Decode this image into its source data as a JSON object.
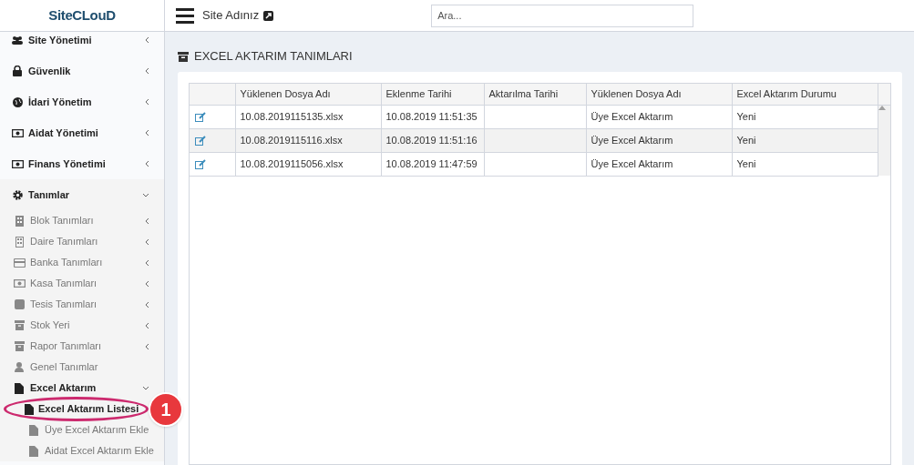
{
  "logo": "SiteCLouD",
  "topbar": {
    "site_name": "Site Adınız",
    "search": {
      "placeholder": "Ara..."
    }
  },
  "sidebar": {
    "items": [
      {
        "label": "Site Yönetimi",
        "expanded": false
      },
      {
        "label": "Güvenlik",
        "expanded": false
      },
      {
        "label": "İdari Yönetim",
        "expanded": false
      },
      {
        "label": "Aidat Yönetimi",
        "expanded": false
      },
      {
        "label": "Finans Yönetimi",
        "expanded": false
      },
      {
        "label": "Tanımlar",
        "expanded": true,
        "children": [
          {
            "label": "Blok Tanımları",
            "expanded": false
          },
          {
            "label": "Daire Tanımları",
            "expanded": false
          },
          {
            "label": "Banka Tanımları",
            "expanded": false
          },
          {
            "label": "Kasa Tanımları",
            "expanded": false
          },
          {
            "label": "Tesis Tanımları",
            "expanded": false
          },
          {
            "label": "Stok Yeri",
            "expanded": false
          },
          {
            "label": "Rapor Tanımları",
            "expanded": false
          },
          {
            "label": "Genel Tanımlar"
          },
          {
            "label": "Excel Aktarım",
            "expanded": true,
            "children": [
              {
                "label": "Excel Aktarım Listesi",
                "selected": true
              },
              {
                "label": "Üye Excel Aktarım Ekle",
                "selected": false
              },
              {
                "label": "Aidat Excel Aktarım Ekle",
                "selected": false
              }
            ]
          }
        ]
      }
    ]
  },
  "page_title": "EXCEL AKTARIM TANIMLARI",
  "table": {
    "columns": [
      "",
      "Yüklenen Dosya Adı",
      "Eklenme Tarihi",
      "Aktarılma Tarihi",
      "Yüklenen Dosya Adı",
      "Excel Aktarım Durumu"
    ],
    "rows": [
      [
        "",
        "10.08.2019115135.xlsx",
        "10.08.2019 11:51:35",
        "",
        "Üye Excel Aktarım",
        "Yeni"
      ],
      [
        "",
        "10.08.2019115116.xlsx",
        "10.08.2019 11:51:16",
        "",
        "Üye Excel Aktarım",
        "Yeni"
      ],
      [
        "",
        "10.08.2019115056.xlsx",
        "10.08.2019 11:47:59",
        "",
        "Üye Excel Aktarım",
        "Yeni"
      ]
    ]
  },
  "callout": {
    "number": "1"
  }
}
